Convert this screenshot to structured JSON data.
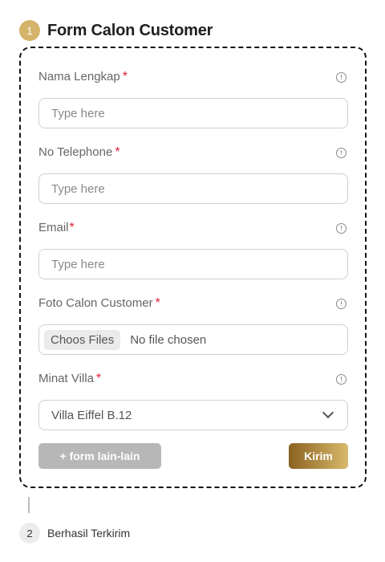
{
  "step1": {
    "number": "1",
    "title": "Form Calon Customer"
  },
  "form": {
    "fields": [
      {
        "label": "Nama Lengkap",
        "required_mark": "*",
        "placeholder": "Type here"
      },
      {
        "label": "No Telephone",
        "required_mark": "*",
        "placeholder": "Type here"
      },
      {
        "label": "Email",
        "required_mark": "*",
        "placeholder": "Type here"
      },
      {
        "label": "Foto Calon Customer",
        "required_mark": "*",
        "choose_label": "Choos Files",
        "status": "No file chosen"
      },
      {
        "label": "Minat Villa",
        "required_mark": "*",
        "selected": "Villa Eiffel B.12"
      }
    ],
    "secondary_button": "+ form lain-lain",
    "submit_button": "Kirim"
  },
  "step2": {
    "number": "2",
    "title": "Berhasil Terkirim"
  },
  "colors": {
    "accent": "#d4b46a",
    "required": "#e0203a",
    "submit_gradient_start": "#8b6220",
    "submit_gradient_end": "#d8b96c",
    "secondary_button": "#b7b7b7"
  },
  "icons": {
    "field_info": "info-circle-icon",
    "select": "chevron-down-icon"
  }
}
